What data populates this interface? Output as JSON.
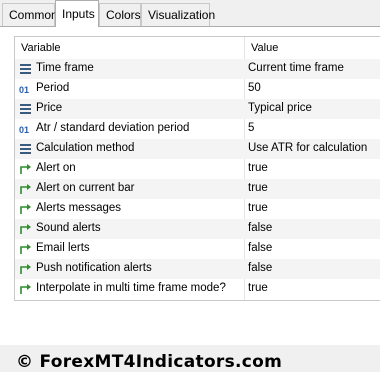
{
  "tabs": [
    "Common",
    "Inputs",
    "Colors",
    "Visualization"
  ],
  "active_tab": "Inputs",
  "table": {
    "col_variable": "Variable",
    "col_value": "Value",
    "rows": [
      {
        "icon": "enum-icon",
        "name": "Time frame",
        "value": "Current time frame"
      },
      {
        "icon": "int-icon",
        "name": "Period",
        "value": "50"
      },
      {
        "icon": "enum-icon",
        "name": "Price",
        "value": "Typical price"
      },
      {
        "icon": "int-icon",
        "name": "Atr / standard deviation period",
        "value": "5"
      },
      {
        "icon": "enum-icon",
        "name": "Calculation method",
        "value": "Use ATR for calculation"
      },
      {
        "icon": "bool-icon",
        "name": "Alert on",
        "value": "true"
      },
      {
        "icon": "bool-icon",
        "name": "Alert on current bar",
        "value": "true"
      },
      {
        "icon": "bool-icon",
        "name": "Alerts messages",
        "value": "true"
      },
      {
        "icon": "bool-icon",
        "name": "Sound alerts",
        "value": "false"
      },
      {
        "icon": "bool-icon",
        "name": "Email lerts",
        "value": "false"
      },
      {
        "icon": "bool-icon",
        "name": "Push notification alerts",
        "value": "false"
      },
      {
        "icon": "bool-icon",
        "name": "Interpolate in multi time frame mode?",
        "value": "true"
      }
    ]
  },
  "watermark": "© ForexMT4Indicators.com",
  "colors": {
    "int_icon": "#1f5fbf",
    "bool_icon": "#2e8b2e",
    "enum_icon": "#3a5a80"
  }
}
